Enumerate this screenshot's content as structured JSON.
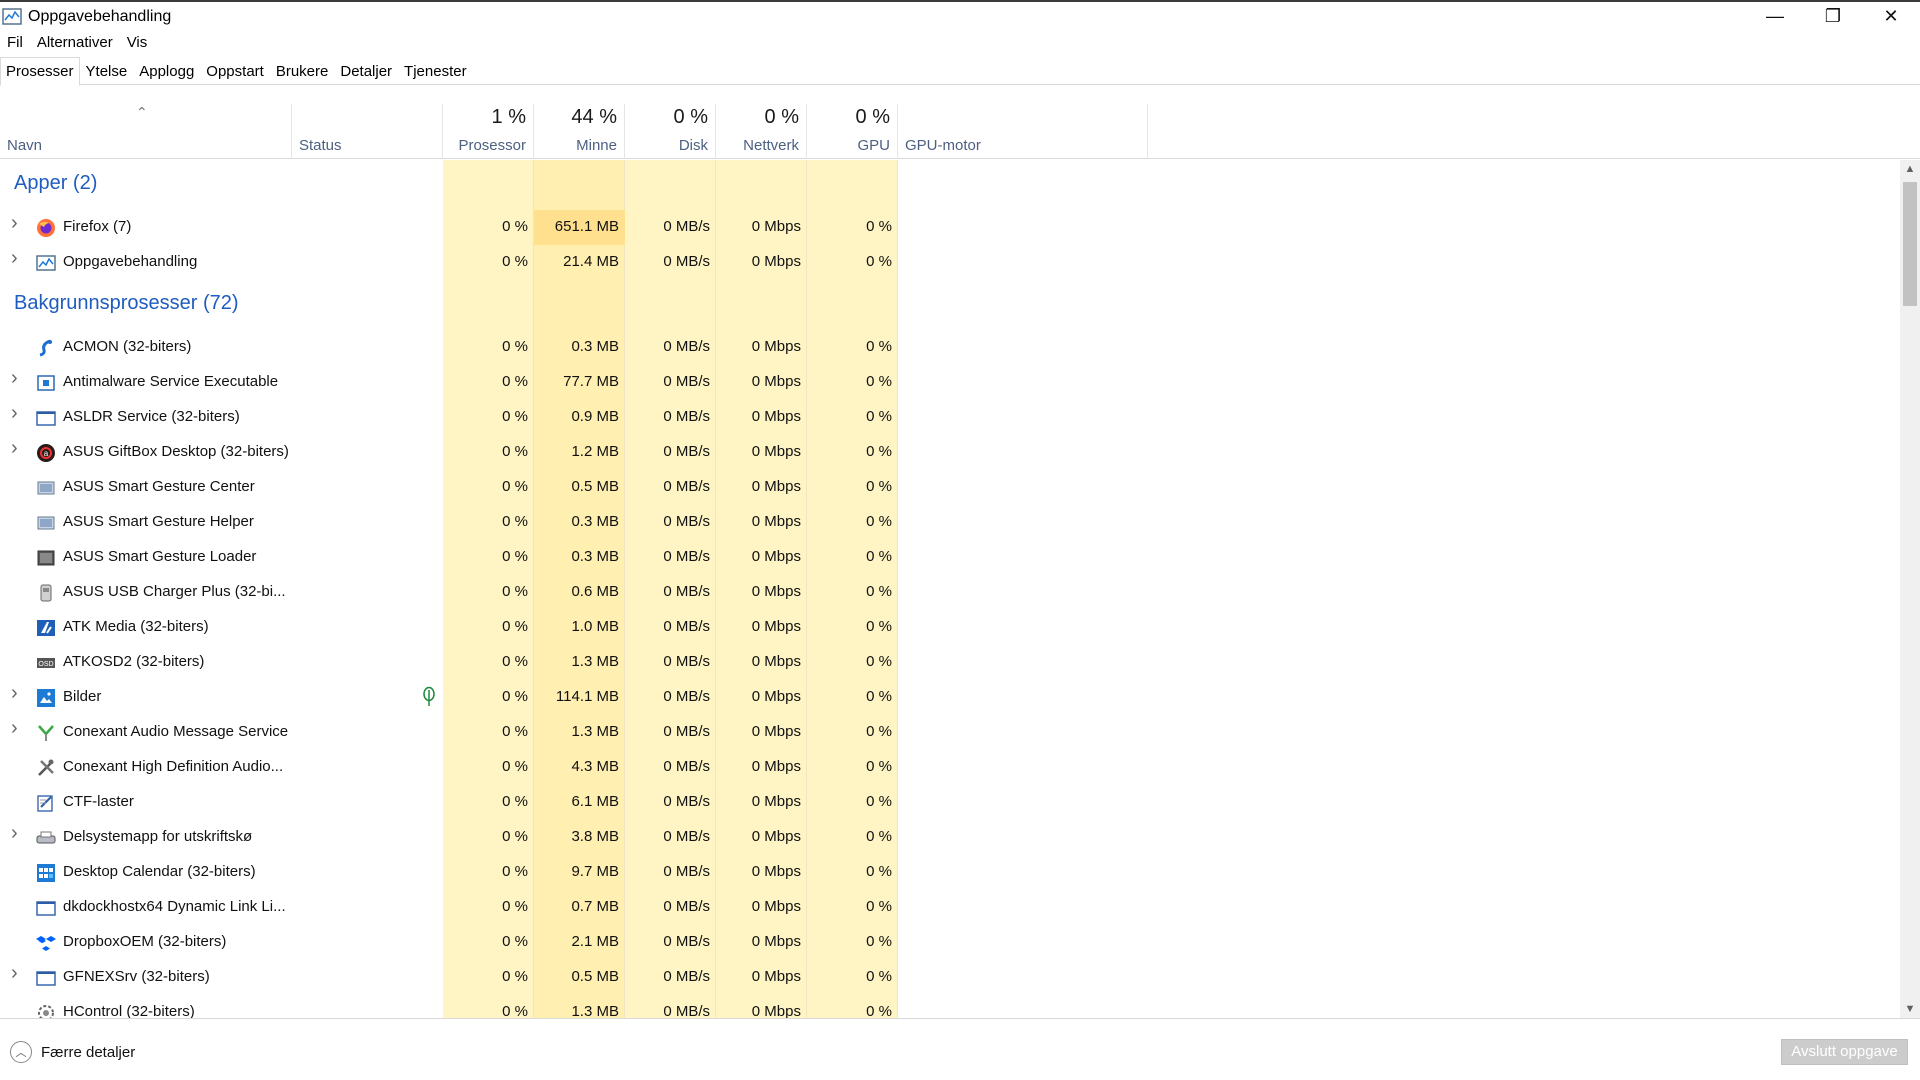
{
  "window": {
    "title": "Oppgavebehandling",
    "controls": {
      "minimize": "—",
      "restore": "❐",
      "close": "✕"
    }
  },
  "menu": [
    "Fil",
    "Alternativer",
    "Vis"
  ],
  "tabs": [
    "Prosesser",
    "Ytelse",
    "Applogg",
    "Oppstart",
    "Brukere",
    "Detaljer",
    "Tjenester"
  ],
  "active_tab": "Prosesser",
  "columns": {
    "name": "Navn",
    "status": "Status",
    "cpu": {
      "pct": "1 %",
      "label": "Prosessor"
    },
    "memory": {
      "pct": "44 %",
      "label": "Minne"
    },
    "disk": {
      "pct": "0 %",
      "label": "Disk"
    },
    "network": {
      "pct": "0 %",
      "label": "Nettverk"
    },
    "gpu": {
      "pct": "0 %",
      "label": "GPU"
    },
    "gpu_engine": "GPU-motor"
  },
  "groups": [
    {
      "label": "Apper (2)",
      "rows": [
        {
          "name": "Firefox (7)",
          "icon": "firefox-icon",
          "expandable": true,
          "cpu": "0 %",
          "mem": "651.1 MB",
          "disk": "0 MB/s",
          "net": "0 Mbps",
          "gpu": "0 %"
        },
        {
          "name": "Oppgavebehandling",
          "icon": "task-manager-icon",
          "expandable": true,
          "cpu": "0 %",
          "mem": "21.4 MB",
          "disk": "0 MB/s",
          "net": "0 Mbps",
          "gpu": "0 %"
        }
      ]
    },
    {
      "label": "Bakgrunnsprosesser (72)",
      "rows": [
        {
          "name": "ACMON (32-biters)",
          "icon": "acmon-icon",
          "expandable": false,
          "cpu": "0 %",
          "mem": "0.3 MB",
          "disk": "0 MB/s",
          "net": "0 Mbps",
          "gpu": "0 %"
        },
        {
          "name": "Antimalware Service Executable",
          "icon": "antimalware-icon",
          "expandable": true,
          "cpu": "0 %",
          "mem": "77.7 MB",
          "disk": "0 MB/s",
          "net": "0 Mbps",
          "gpu": "0 %"
        },
        {
          "name": "ASLDR Service (32-biters)",
          "icon": "window-icon",
          "expandable": true,
          "cpu": "0 %",
          "mem": "0.9 MB",
          "disk": "0 MB/s",
          "net": "0 Mbps",
          "gpu": "0 %"
        },
        {
          "name": "ASUS GiftBox Desktop (32-biters)",
          "icon": "giftbox-icon",
          "expandable": true,
          "cpu": "0 %",
          "mem": "1.2 MB",
          "disk": "0 MB/s",
          "net": "0 Mbps",
          "gpu": "0 %"
        },
        {
          "name": "ASUS Smart Gesture Center",
          "icon": "touchpad-icon",
          "expandable": false,
          "cpu": "0 %",
          "mem": "0.5 MB",
          "disk": "0 MB/s",
          "net": "0 Mbps",
          "gpu": "0 %"
        },
        {
          "name": "ASUS Smart Gesture Helper",
          "icon": "touchpad-icon",
          "expandable": false,
          "cpu": "0 %",
          "mem": "0.3 MB",
          "disk": "0 MB/s",
          "net": "0 Mbps",
          "gpu": "0 %"
        },
        {
          "name": "ASUS Smart Gesture Loader",
          "icon": "gesture-loader-icon",
          "expandable": false,
          "cpu": "0 %",
          "mem": "0.3 MB",
          "disk": "0 MB/s",
          "net": "0 Mbps",
          "gpu": "0 %"
        },
        {
          "name": "ASUS USB Charger Plus (32-bi...",
          "icon": "usb-charger-icon",
          "expandable": false,
          "cpu": "0 %",
          "mem": "0.6 MB",
          "disk": "0 MB/s",
          "net": "0 Mbps",
          "gpu": "0 %"
        },
        {
          "name": "ATK Media (32-biters)",
          "icon": "atk-media-icon",
          "expandable": false,
          "cpu": "0 %",
          "mem": "1.0 MB",
          "disk": "0 MB/s",
          "net": "0 Mbps",
          "gpu": "0 %"
        },
        {
          "name": "ATKOSD2 (32-biters)",
          "icon": "osd-icon",
          "expandable": false,
          "cpu": "0 %",
          "mem": "1.3 MB",
          "disk": "0 MB/s",
          "net": "0 Mbps",
          "gpu": "0 %"
        },
        {
          "name": "Bilder",
          "icon": "photos-icon",
          "expandable": true,
          "suspended": true,
          "cpu": "0 %",
          "mem": "114.1 MB",
          "disk": "0 MB/s",
          "net": "0 Mbps",
          "gpu": "0 %"
        },
        {
          "name": "Conexant Audio Message Service",
          "icon": "conexant-icon",
          "expandable": true,
          "cpu": "0 %",
          "mem": "1.3 MB",
          "disk": "0 MB/s",
          "net": "0 Mbps",
          "gpu": "0 %"
        },
        {
          "name": "Conexant High Definition Audio...",
          "icon": "tools-icon",
          "expandable": false,
          "cpu": "0 %",
          "mem": "4.3 MB",
          "disk": "0 MB/s",
          "net": "0 Mbps",
          "gpu": "0 %"
        },
        {
          "name": "CTF-laster",
          "icon": "ctf-icon",
          "expandable": false,
          "cpu": "0 %",
          "mem": "6.1 MB",
          "disk": "0 MB/s",
          "net": "0 Mbps",
          "gpu": "0 %"
        },
        {
          "name": "Delsystemapp for utskriftskø",
          "icon": "printer-icon",
          "expandable": true,
          "cpu": "0 %",
          "mem": "3.8 MB",
          "disk": "0 MB/s",
          "net": "0 Mbps",
          "gpu": "0 %"
        },
        {
          "name": "Desktop Calendar (32-biters)",
          "icon": "calendar-icon",
          "expandable": false,
          "cpu": "0 %",
          "mem": "9.7 MB",
          "disk": "0 MB/s",
          "net": "0 Mbps",
          "gpu": "0 %"
        },
        {
          "name": "dkdockhostx64 Dynamic Link Li...",
          "icon": "window-icon",
          "expandable": false,
          "cpu": "0 %",
          "mem": "0.7 MB",
          "disk": "0 MB/s",
          "net": "0 Mbps",
          "gpu": "0 %"
        },
        {
          "name": "DropboxOEM (32-biters)",
          "icon": "dropbox-icon",
          "expandable": false,
          "cpu": "0 %",
          "mem": "2.1 MB",
          "disk": "0 MB/s",
          "net": "0 Mbps",
          "gpu": "0 %"
        },
        {
          "name": "GFNEXSrv (32-biters)",
          "icon": "window-icon",
          "expandable": true,
          "cpu": "0 %",
          "mem": "0.5 MB",
          "disk": "0 MB/s",
          "net": "0 Mbps",
          "gpu": "0 %"
        },
        {
          "name": "HControl (32-biters)",
          "icon": "hcontrol-icon",
          "expandable": false,
          "cpu": "0 %",
          "mem": "1.3 MB",
          "disk": "0 MB/s",
          "net": "0 Mbps",
          "gpu": "0 %"
        }
      ]
    }
  ],
  "colors": {
    "cpu_bg": "#fff4c4",
    "mem_bg": "#ffefb1",
    "mem_highlight": "#ffe08f",
    "disk_bg": "#fff4c4",
    "net_bg": "#fff4c4",
    "gpu_bg": "#fff4c4",
    "group_blue": "#1f5cbf"
  },
  "footer": {
    "fewer_details": "Færre detaljer",
    "end_task": "Avslutt oppgave"
  }
}
